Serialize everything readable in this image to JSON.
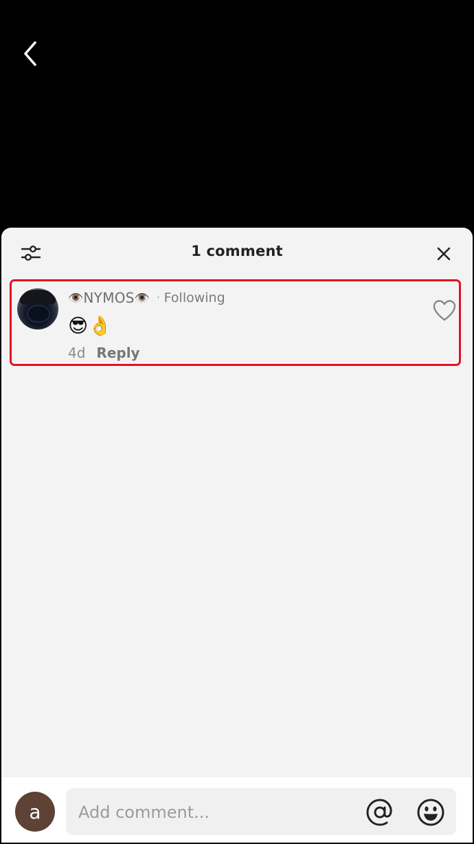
{
  "header": {
    "back_icon": "chevron-left-icon"
  },
  "sheet": {
    "title": "1 comment",
    "filter_icon": "sliders-icon",
    "close_icon": "close-icon"
  },
  "comment": {
    "username_prefix_emoji": "👁️",
    "username": "NYMOS",
    "username_suffix_emoji": "👁️",
    "separator": "·",
    "relationship": "Following",
    "text": "😎👌",
    "time": "4d",
    "reply_label": "Reply",
    "like_icon": "heart-outline-icon",
    "highlight_color": "#e5101e"
  },
  "composer": {
    "avatar_letter": "a",
    "placeholder": "Add comment...",
    "mention_icon": "at-sign-icon",
    "emoji_icon": "smiley-icon"
  }
}
